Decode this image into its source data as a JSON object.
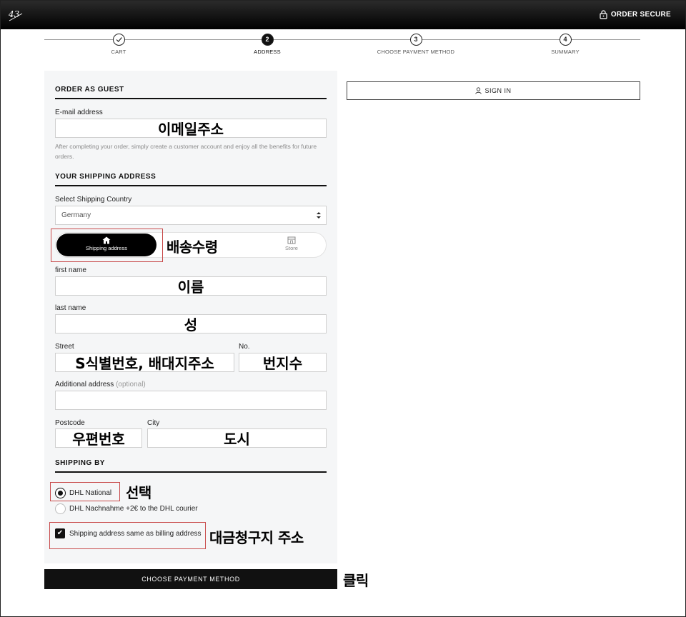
{
  "header": {
    "logo_text": "43",
    "secure_label": "ORDER SECURE"
  },
  "steps": [
    {
      "label": "CART",
      "number": "",
      "state": "done"
    },
    {
      "label": "ADDRESS",
      "number": "2",
      "state": "active"
    },
    {
      "label": "CHOOSE PAYMENT METHOD",
      "number": "3",
      "state": "todo"
    },
    {
      "label": "SUMMARY",
      "number": "4",
      "state": "todo"
    }
  ],
  "guest": {
    "title": "ORDER AS GUEST",
    "email_label": "E-mail address",
    "email_value": "이메일주소",
    "help_text": "After completing your order, simply create a customer account and enjoy all the benefits for future orders."
  },
  "shipping": {
    "title": "YOUR SHIPPING ADDRESS",
    "country_label": "Select Shipping Country",
    "country_value": "Germany",
    "toggle_address": "Shipping address",
    "toggle_store": "Store",
    "toggle_note": "배송수령",
    "first_name_label": "first name",
    "first_name_value": "이름",
    "last_name_label": "last name",
    "last_name_value": "성",
    "street_label": "Street",
    "street_value": "S식별번호, 배대지주소",
    "no_label": "No.",
    "no_value": "번지수",
    "additional_label": "Additional address",
    "additional_optional": "(optional)",
    "additional_value": "",
    "postcode_label": "Postcode",
    "postcode_value": "우편번호",
    "city_label": "City",
    "city_value": "도시"
  },
  "shipping_by": {
    "title": "SHIPPING BY",
    "option1": "DHL National",
    "option1_note": "선택",
    "option2": "DHL Nachnahme +2€ to the DHL courier",
    "billing_same": "Shipping address same as billing address",
    "billing_note": "대금청구지 주소"
  },
  "actions": {
    "primary": "CHOOSE PAYMENT METHOD",
    "primary_note": "클릭",
    "sign_in": "SIGN IN"
  }
}
